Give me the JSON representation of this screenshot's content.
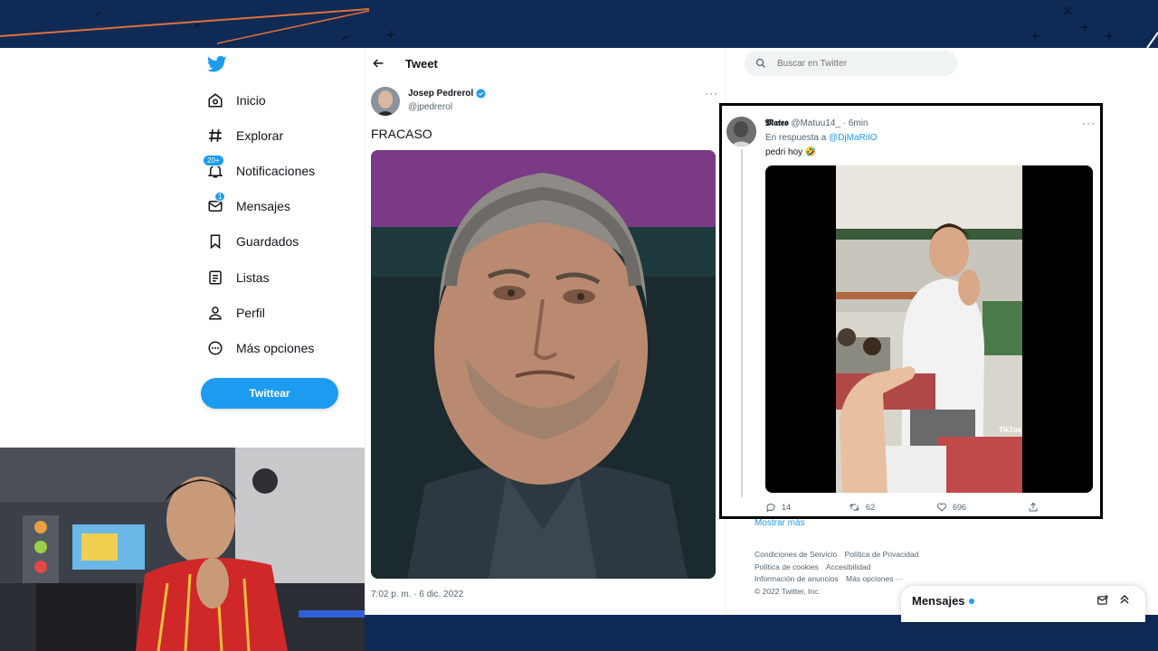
{
  "sidebar": {
    "items": [
      {
        "label": "Inicio",
        "icon": "home-icon"
      },
      {
        "label": "Explorar",
        "icon": "hashtag-icon"
      },
      {
        "label": "Notificaciones",
        "icon": "bell-icon",
        "badge": "20+"
      },
      {
        "label": "Mensajes",
        "icon": "envelope-icon",
        "badge": "1"
      },
      {
        "label": "Guardados",
        "icon": "bookmark-icon"
      },
      {
        "label": "Listas",
        "icon": "list-icon"
      },
      {
        "label": "Perfil",
        "icon": "person-icon"
      },
      {
        "label": "Más opciones",
        "icon": "more-circle-icon"
      }
    ],
    "tweet_button": "Twittear"
  },
  "header": {
    "title": "Tweet"
  },
  "tweet": {
    "author_name": "Josep Pedrerol",
    "author_handle": "@jpedrerol",
    "text": "FRACASO",
    "timestamp": "7:02 p. m. · 6 dic. 2022"
  },
  "search": {
    "placeholder": "Buscar en Twitter"
  },
  "reply": {
    "name": "𝕸𝖆𝖙𝖊𝖔",
    "handle": "@Matuu14_",
    "time": "· 6min",
    "reply_to_prefix": "En respuesta a",
    "reply_to_mention": "@DjMaRiIO",
    "text": "pedri hoy 🤣",
    "video_watermark": "TikTok",
    "replies": "14",
    "retweets": "62",
    "likes": "696"
  },
  "right_panel": {
    "show_more": "Mostrar más",
    "footer_line1": [
      "Condiciones de Servicio",
      "Política de Privacidad"
    ],
    "footer_line2": [
      "Política de cookies",
      "Accesibilidad"
    ],
    "footer_line3": [
      "Información de anuncios",
      "Más opciones ···"
    ],
    "copyright": "© 2022 Twitter, Inc."
  },
  "messages_drawer": {
    "title": "Mensajes"
  },
  "colors": {
    "accent": "#1d9bf0",
    "banner": "#0f2a55",
    "text": "#0f1419",
    "muted": "#536471"
  }
}
